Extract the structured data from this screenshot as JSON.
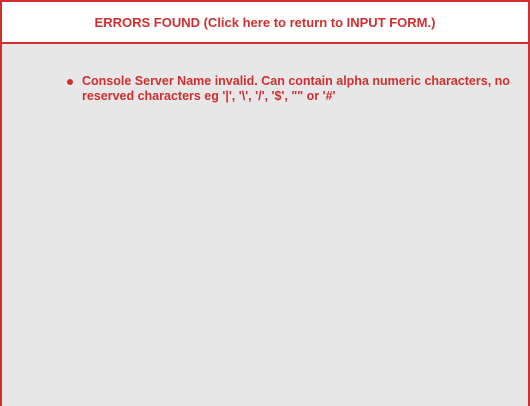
{
  "header": {
    "link_text": "ERRORS FOUND (Click here to return to INPUT FORM.)"
  },
  "errors": [
    {
      "message": "Console Server Name invalid. Can contain alpha numeric characters, no reserved characters eg '|', '\\', '/', '$', \"\" or '#'"
    }
  ],
  "colors": {
    "accent": "#d12f2f",
    "background": "#e7e7e7",
    "header_background": "#ffffff"
  }
}
